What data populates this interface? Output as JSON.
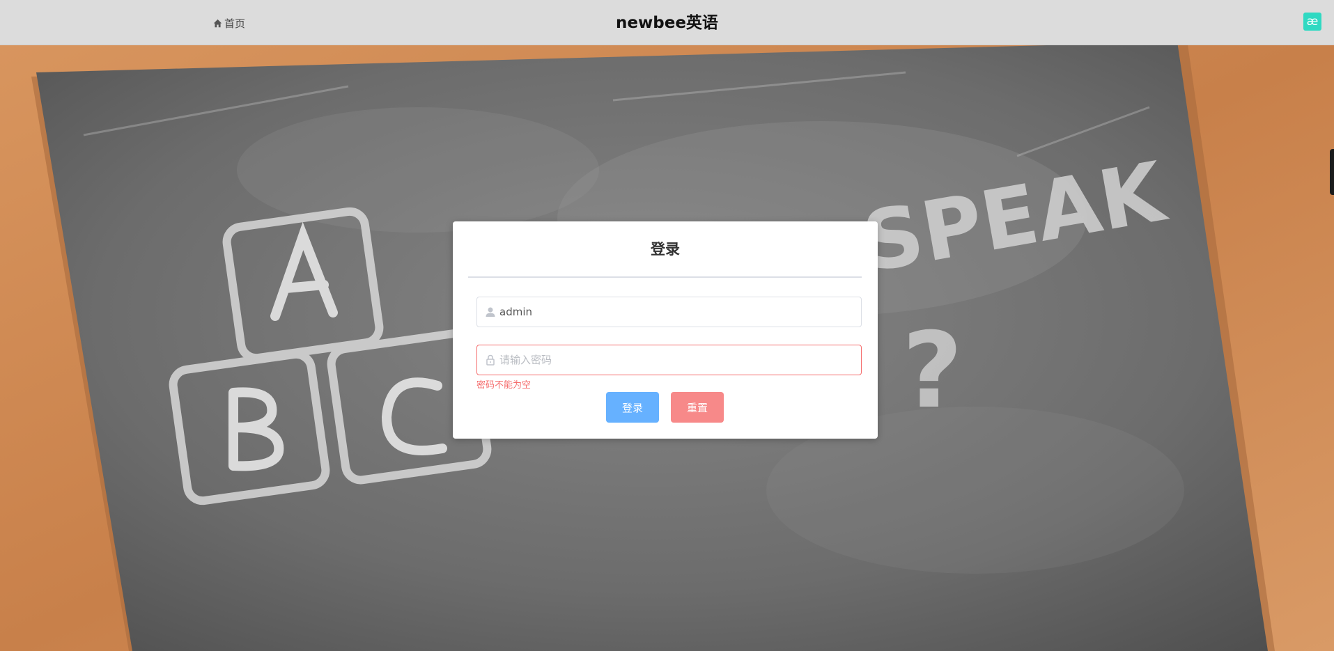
{
  "header": {
    "home_label": "首页",
    "site_title": "newbee英语",
    "home_icon": "home-icon",
    "app_icon": "æ"
  },
  "login": {
    "title": "登录",
    "username": {
      "value": "admin",
      "icon": "user-icon"
    },
    "password": {
      "value": "",
      "placeholder": "请输入密码",
      "icon": "lock-icon",
      "error": "密码不能为空"
    },
    "login_button": "登录",
    "reset_button": "重置"
  },
  "colors": {
    "header_bg": "#dcdcdc",
    "primary": "#66b1ff",
    "danger": "#f78989",
    "error_text": "#f56c6c",
    "app_icon_bg": "#2fd9c2"
  }
}
